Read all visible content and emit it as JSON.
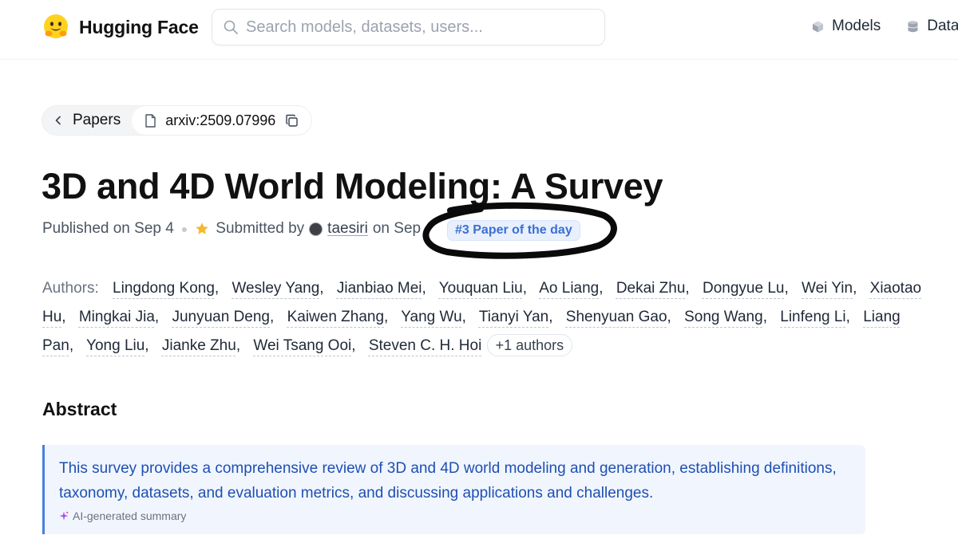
{
  "header": {
    "logo_text": "Hugging Face",
    "search_placeholder": "Search models, datasets, users...",
    "nav": [
      {
        "label": "Models",
        "icon": "cube-icon"
      },
      {
        "label": "Datasets",
        "icon": "database-icon"
      }
    ]
  },
  "breadcrumb": {
    "back_label": "Papers",
    "paper_id": "arxiv:2509.07996"
  },
  "paper": {
    "title": "3D and 4D World Modeling: A Survey",
    "published": "Published on Sep 4",
    "submitted_by_label": "Submitted by",
    "submitter": "taesiri",
    "submitted_on": "on Sep",
    "badge": "#3 Paper of the day"
  },
  "authors": {
    "label": "Authors:",
    "names": [
      "Lingdong Kong",
      "Wesley Yang",
      "Jianbiao Mei",
      "Youquan Liu",
      "Ao Liang",
      "Dekai Zhu",
      "Dongyue Lu",
      "Wei Yin",
      "Xiaotao Hu",
      "Mingkai Jia",
      "Junyuan Deng",
      "Kaiwen Zhang",
      "Yang Wu",
      "Tianyi Yan",
      "Shenyuan Gao",
      "Song Wang",
      "Linfeng Li",
      "Liang Pan",
      "Yong Liu",
      "Jianke Zhu",
      "Wei Tsang Ooi",
      "Steven C. H. Hoi"
    ],
    "more_label": "+1 authors"
  },
  "abstract": {
    "heading": "Abstract",
    "summary": "This survey provides a comprehensive review of 3D and 4D world modeling and generation, establishing definitions, taxonomy, datasets, and evaluation metrics, and discussing applications and challenges.",
    "summary_label": "AI-generated summary"
  },
  "colors": {
    "badge_text": "#3b6fd4",
    "summary_text": "#1e4fb3",
    "summary_border": "#4a7fe0"
  }
}
